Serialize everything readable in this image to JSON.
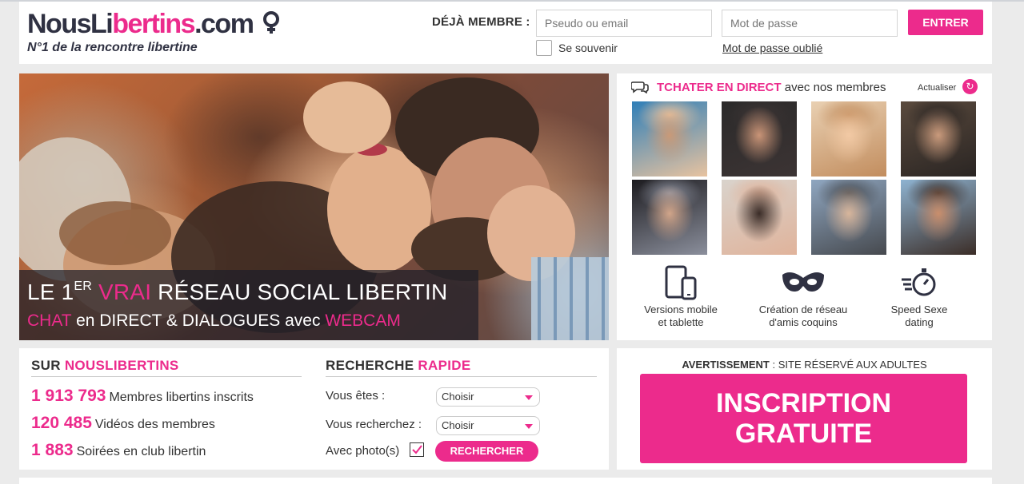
{
  "brand": {
    "logo_part1": "NousLi",
    "logo_part2": "bertins",
    "logo_part3": ".com",
    "tagline": "N°1 de la rencontre libertine",
    "accent_color": "#ec2b8c",
    "dark_color": "#2f3142"
  },
  "login": {
    "label": "DÉJÀ MEMBRE :",
    "pseudo_placeholder": "Pseudo ou email",
    "password_placeholder": "Mot de passe",
    "submit": "ENTRER",
    "remember": "Se souvenir",
    "forgot": "Mot de passe oublié"
  },
  "hero": {
    "line1_a": "LE 1",
    "line1_sup": "ER",
    "line1_b": "VRAI",
    "line1_c": "RÉSEAU SOCIAL LIBERTIN",
    "line2_a": "CHAT",
    "line2_b": "en DIRECT & DIALOGUES avec",
    "line2_c": "WEBCAM"
  },
  "chat": {
    "title_pink": "TCHATER EN DIRECT",
    "title_rest": "avec nos membres",
    "refresh": "Actualiser",
    "thumbs": [
      {
        "name": "member-photo-1",
        "colors": [
          "#2f7fb8",
          "#c99a78",
          "#e8c3a0"
        ]
      },
      {
        "name": "member-photo-2",
        "colors": [
          "#2b2a2a",
          "#c99477",
          "#3c3434"
        ]
      },
      {
        "name": "member-photo-3",
        "colors": [
          "#e9d0b2",
          "#f2c9a4",
          "#c28d5e"
        ]
      },
      {
        "name": "member-photo-4",
        "colors": [
          "#5a4a3d",
          "#c99a7c",
          "#2a2523"
        ]
      },
      {
        "name": "member-photo-5",
        "colors": [
          "#1c1b1f",
          "#d1a58a",
          "#8b8f9c"
        ]
      },
      {
        "name": "member-photo-6",
        "colors": [
          "#d9d3cc",
          "#3a2c27",
          "#e0b39b"
        ]
      },
      {
        "name": "member-photo-7",
        "colors": [
          "#8fa6c0",
          "#d7b59b",
          "#46494e"
        ]
      },
      {
        "name": "member-photo-8",
        "colors": [
          "#8eb3d1",
          "#c98e6c",
          "#3b2d27"
        ]
      }
    ],
    "features": [
      {
        "line1": "Versions mobile",
        "line2": "et tablette",
        "icon": "mobile-tablet-icon"
      },
      {
        "line1": "Création de réseau",
        "line2": "d'amis coquins",
        "icon": "mask-icon"
      },
      {
        "line1": "Speed Sexe",
        "line2": "dating",
        "icon": "stopwatch-icon"
      }
    ]
  },
  "stats": {
    "title_a": "SUR",
    "title_b": "NOUSLIBERTINS",
    "items": [
      {
        "value": "1 913 793",
        "label": "Membres libertins inscrits"
      },
      {
        "value": "120 485",
        "label": "Vidéos des membres"
      },
      {
        "value": "1 883",
        "label": "Soirées en club libertin"
      }
    ]
  },
  "search": {
    "title_a": "RECHERCHE",
    "title_b": "RAPIDE",
    "you_are": "Vous êtes :",
    "you_seek": "Vous recherchez :",
    "with_photo": "Avec photo(s)",
    "select_default": "Choisir",
    "submit": "RECHERCHER"
  },
  "warning": {
    "bold": "AVERTISSEMENT",
    "rest": ": SITE RÉSERVÉ AUX ADULTES",
    "cta_line1": "INSCRIPTION",
    "cta_line2": "GRATUITE"
  }
}
